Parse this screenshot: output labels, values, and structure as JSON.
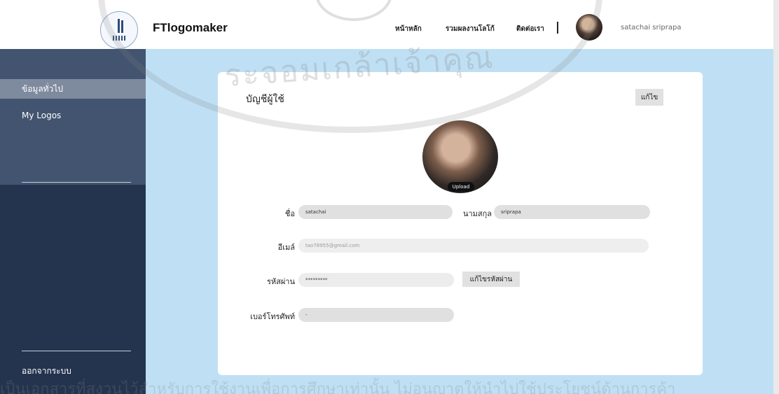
{
  "app": {
    "brand": "FTlogomaker"
  },
  "topnav": {
    "items": [
      {
        "label": "หน้าหลัก"
      },
      {
        "label": "รวมผลงานโลโก้"
      },
      {
        "label": "ติดต่อเรา"
      }
    ],
    "user_name": "satachai sriprapa"
  },
  "sidebar": {
    "items": [
      {
        "label": "ข้อมูลทั่วไป",
        "active": true
      },
      {
        "label": "My Logos",
        "active": false
      }
    ],
    "logout_label": "ออกจากระบบ"
  },
  "profile": {
    "title": "บัญชีผู้ใช้",
    "edit_label": "แก้ไข",
    "upload_label": "Upload",
    "first_name_label": "ชื่อ",
    "first_name": "satachai",
    "last_name_label": "นามสกุล",
    "last_name": "sriprapa",
    "email_label": "อีเมล์",
    "email": "tao78955@gmail.com",
    "password_label": "รหัสผ่าน",
    "password": "*********",
    "change_password_label": "แก้ไขรหัสผ่าน",
    "phone_label": "เบอร์โทรศัพท์",
    "phone": "-"
  },
  "watermark": {
    "arc_text": "ระจอมเกล้าเจ้าคุณ",
    "bottom_text": "เป็นเอกสารที่สงวนไว้สำหรับการใช้งานเพื่อการศึกษาเท่านั้น ไม่อนุญาตให้นำไปใช้ประโยชน์ด้านการค้า"
  },
  "colors": {
    "sidebar": "#24344f",
    "sidebar_upper": "#42546f",
    "active_item": "#7e8a9e",
    "content_bg": "#bfe0f4",
    "field_bg": "#e0e0e0"
  }
}
